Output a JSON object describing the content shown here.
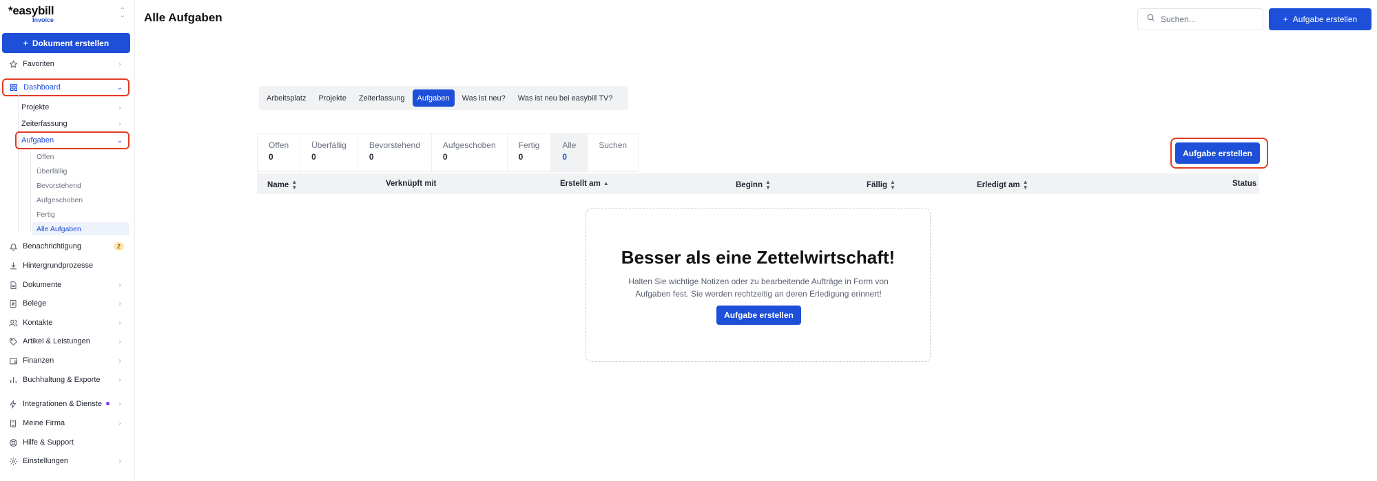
{
  "app": {
    "logo_text": "easybill",
    "logo_sub": "Invoice"
  },
  "sidebar": {
    "create_document": "Dokument erstellen",
    "items": [
      {
        "label": "Favoriten"
      },
      {
        "label": "Dashboard"
      },
      {
        "label": "Benachrichtigung",
        "badge": "2"
      },
      {
        "label": "Hintergrundprozesse"
      },
      {
        "label": "Dokumente"
      },
      {
        "label": "Belege"
      },
      {
        "label": "Kontakte"
      },
      {
        "label": "Artikel & Leistungen"
      },
      {
        "label": "Finanzen"
      },
      {
        "label": "Buchhaltung & Exporte"
      },
      {
        "label": "Integrationen & Dienste"
      },
      {
        "label": "Meine Firma"
      },
      {
        "label": "Hilfe & Support"
      },
      {
        "label": "Einstellungen"
      }
    ],
    "dashboard_sub": [
      {
        "label": "Projekte"
      },
      {
        "label": "Zeiterfassung"
      },
      {
        "label": "Aufgaben"
      }
    ],
    "tasks_sub": [
      {
        "label": "Offen"
      },
      {
        "label": "Überfällig"
      },
      {
        "label": "Bevorstehend"
      },
      {
        "label": "Aufgeschoben"
      },
      {
        "label": "Fertig"
      },
      {
        "label": "Alle Aufgaben"
      }
    ]
  },
  "header": {
    "title": "Alle Aufgaben",
    "search_placeholder": "Suchen...",
    "create_task": "Aufgabe erstellen"
  },
  "section_tabs": [
    {
      "label": "Arbeitsplatz"
    },
    {
      "label": "Projekte"
    },
    {
      "label": "Zeiterfassung"
    },
    {
      "label": "Aufgaben",
      "active": true
    },
    {
      "label": "Was ist neu?"
    },
    {
      "label": "Was ist neu bei easybill TV?"
    }
  ],
  "status_tabs": [
    {
      "label": "Offen",
      "count": "0"
    },
    {
      "label": "Überfällig",
      "count": "0"
    },
    {
      "label": "Bevorstehend",
      "count": "0"
    },
    {
      "label": "Aufgeschoben",
      "count": "0"
    },
    {
      "label": "Fertig",
      "count": "0"
    },
    {
      "label": "Alle",
      "count": "0",
      "active": true
    },
    {
      "label": "Suchen",
      "count": ""
    }
  ],
  "main": {
    "create_task": "Aufgabe erstellen"
  },
  "table": {
    "columns": [
      {
        "label": "Name"
      },
      {
        "label": "Verknüpft mit"
      },
      {
        "label": "Erstellt am"
      },
      {
        "label": "Beginn"
      },
      {
        "label": "Fällig"
      },
      {
        "label": "Erledigt am"
      },
      {
        "label": "Status"
      }
    ]
  },
  "empty_state": {
    "title": "Besser als eine Zettelwirtschaft!",
    "text": "Halten Sie wichtige Notizen oder zu bearbeitende Aufträge in Form von Aufgaben fest. Sie werden rechtzeitig an deren Erledigung erinnert!",
    "button": "Aufgabe erstellen"
  },
  "colors": {
    "accent": "#1d4fd8",
    "highlight": "#e23b24"
  }
}
